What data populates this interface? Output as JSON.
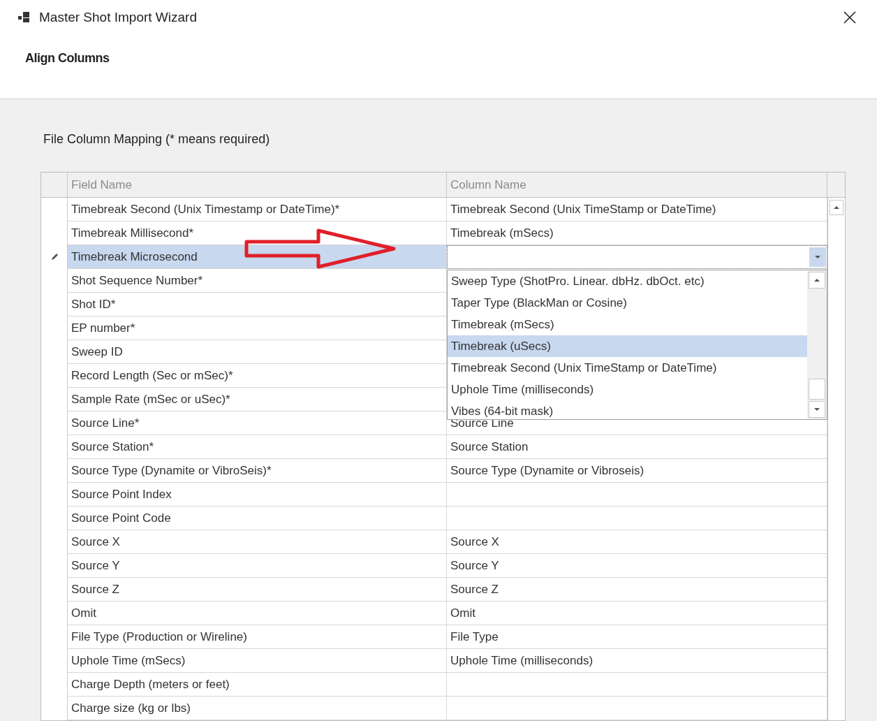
{
  "window": {
    "title": "Master Shot Import Wizard"
  },
  "section_title": "Align Columns",
  "mapping_label": "File Column Mapping (* means required)",
  "table": {
    "columns": [
      "Field Name",
      "Column Name"
    ],
    "rows": [
      {
        "field_name": "Timebreak Second (Unix Timestamp or DateTime)*",
        "column_name": "Timebreak Second (Unix TimeStamp or DateTime)",
        "selected": false
      },
      {
        "field_name": "Timebreak Millisecond*",
        "column_name": "Timebreak (mSecs)",
        "selected": false
      },
      {
        "field_name": "Timebreak Microsecond",
        "selected": true
      },
      {
        "field_name": "Shot Sequence Number*",
        "selected": false
      },
      {
        "field_name": "Shot ID*",
        "selected": false
      },
      {
        "field_name": "EP number*",
        "selected": false
      },
      {
        "field_name": "Sweep ID",
        "selected": false
      },
      {
        "field_name": "Record Length (Sec or mSec)*",
        "selected": false
      },
      {
        "field_name": "Sample Rate (mSec or uSec)*",
        "selected": false
      },
      {
        "field_name": "Source Line*",
        "column_name": "Source Line",
        "selected": false
      },
      {
        "field_name": "Source Station*",
        "column_name": "Source Station",
        "selected": false
      },
      {
        "field_name": "Source Type (Dynamite or VibroSeis)*",
        "column_name": "Source Type (Dynamite or Vibroseis)",
        "selected": false
      },
      {
        "field_name": "Source Point Index",
        "selected": false
      },
      {
        "field_name": "Source Point Code",
        "selected": false
      },
      {
        "field_name": "Source X",
        "column_name": "Source X",
        "selected": false
      },
      {
        "field_name": "Source Y",
        "column_name": "Source Y",
        "selected": false
      },
      {
        "field_name": "Source Z",
        "column_name": "Source Z",
        "selected": false
      },
      {
        "field_name": "Omit",
        "column_name": "Omit",
        "selected": false
      },
      {
        "field_name": "File Type (Production or Wireline)",
        "column_name": "File Type",
        "selected": false
      },
      {
        "field_name": "Uphole Time (mSecs)",
        "column_name": "Uphole Time (milliseconds)",
        "selected": false
      },
      {
        "field_name": "Charge Depth (meters or feet)",
        "selected": false
      },
      {
        "field_name": "Charge size (kg or lbs)",
        "selected": false
      }
    ],
    "dropdown": {
      "options": [
        {
          "label": "Sweep Type (ShotPro. Linear. dbHz. dbOct. etc)",
          "selected": false
        },
        {
          "label": "Taper Type (BlackMan or Cosine)",
          "selected": false
        },
        {
          "label": "Timebreak (mSecs)",
          "selected": false
        },
        {
          "label": "Timebreak (uSecs)",
          "selected": true
        },
        {
          "label": "Timebreak Second (Unix TimeStamp or DateTime)",
          "selected": false
        },
        {
          "label": "Uphole Time (milliseconds)",
          "selected": false
        },
        {
          "label": "Vibes (64-bit mask)",
          "selected": false
        }
      ]
    }
  }
}
